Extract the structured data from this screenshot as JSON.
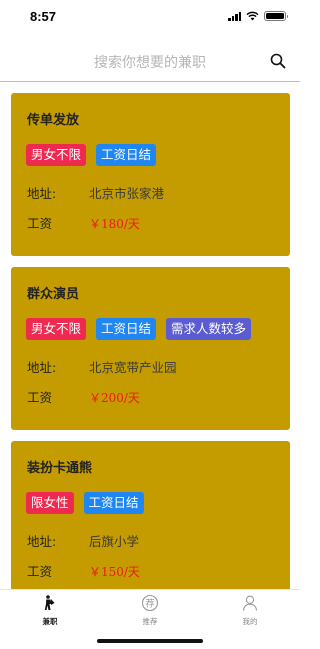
{
  "status_bar": {
    "time": "8:57"
  },
  "search": {
    "placeholder": "搜索你想要的兼职"
  },
  "jobs": [
    {
      "title": "传单发放",
      "tags": [
        "男女不限",
        "工资日结"
      ],
      "address_label": "地址:",
      "address": "北京市张家港",
      "pay_label": "工资",
      "pay": "￥180/天"
    },
    {
      "title": "群众演员",
      "tags": [
        "男女不限",
        "工资日结",
        "需求人数较多"
      ],
      "address_label": "地址:",
      "address": "北京宽带产业园",
      "pay_label": "工资",
      "pay": "￥200/天"
    },
    {
      "title": "装扮卡通熊",
      "tags": [
        "限女性",
        "工资日结"
      ],
      "address_label": "地址:",
      "address": "后旗小学",
      "pay_label": "工资",
      "pay": "￥150/天"
    }
  ],
  "tab_bar": {
    "tabs": [
      {
        "label": "兼职",
        "icon": "person-flag-icon",
        "active": true
      },
      {
        "label": "推荐",
        "icon": "recommend-circle-icon",
        "active": false
      },
      {
        "label": "我的",
        "icon": "profile-icon",
        "active": false
      }
    ]
  },
  "colors": {
    "card_bg": "#c49c00",
    "tag_red": "#ee2a50",
    "tag_blue": "#1f86f2",
    "tag_purple": "#5b5bd2",
    "salary": "#ee1a1a",
    "search_divider": "#f0b27a"
  }
}
